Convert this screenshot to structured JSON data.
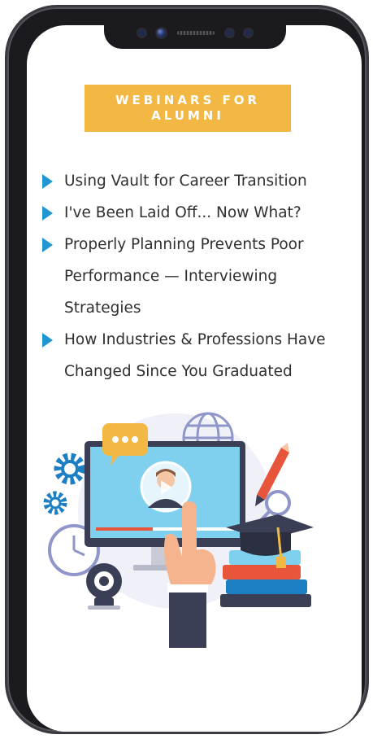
{
  "title": {
    "line1": "WEBINARS FOR",
    "line2": "ALUMNI"
  },
  "topics": [
    {
      "text": "Using Vault for Career Transition"
    },
    {
      "text": "I've Been Laid Off... Now What?"
    },
    {
      "text": "Properly Planning Prevents Poor Performance — Interviewing Strategies"
    },
    {
      "text": "How Industries & Professions Have Changed Since You Graduated"
    }
  ],
  "colors": {
    "title_bg": "#f3b844",
    "bullet": "#2196d3",
    "text": "#2f2f2f",
    "frame": "#1b1b1f"
  },
  "icons": {
    "bullet": "triangle-bullet-icon",
    "illustration": "webinar-computer-illustration"
  }
}
